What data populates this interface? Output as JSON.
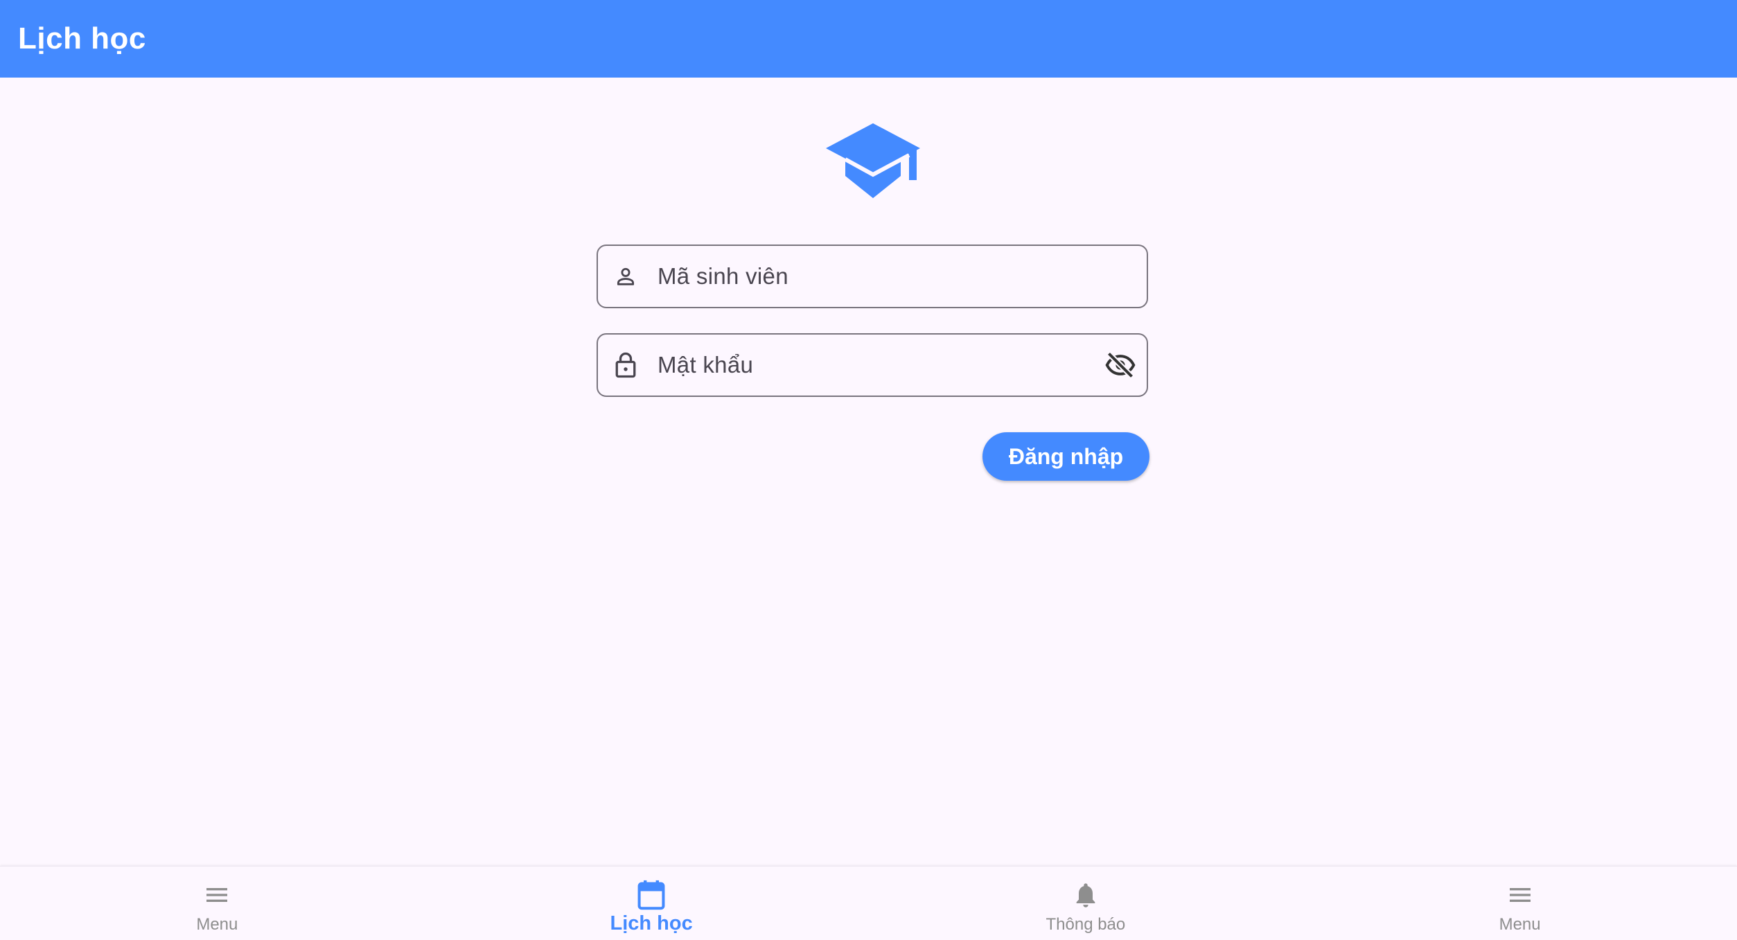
{
  "app_bar": {
    "title": "Lịch học",
    "color": "#448aff"
  },
  "logo": {
    "icon": "graduation-cap-icon",
    "color": "#448aff"
  },
  "login_form": {
    "student_id": {
      "icon": "person-icon",
      "placeholder": "Mã sinh viên",
      "value": ""
    },
    "password": {
      "icon": "lock-icon",
      "placeholder": "Mật khẩu",
      "value": "",
      "toggle_icon": "visibility-off-icon"
    },
    "submit_label": "Đăng nhập"
  },
  "bottom_nav": {
    "active_color": "#448aff",
    "inactive_color": "#8e8e8e",
    "items": [
      {
        "label": "Menu",
        "icon": "menu-icon",
        "active": false
      },
      {
        "label": "Lịch học",
        "icon": "calendar-icon",
        "active": true
      },
      {
        "label": "Thông báo",
        "icon": "bell-icon",
        "active": false
      },
      {
        "label": "Menu",
        "icon": "menu-icon",
        "active": false
      }
    ]
  }
}
